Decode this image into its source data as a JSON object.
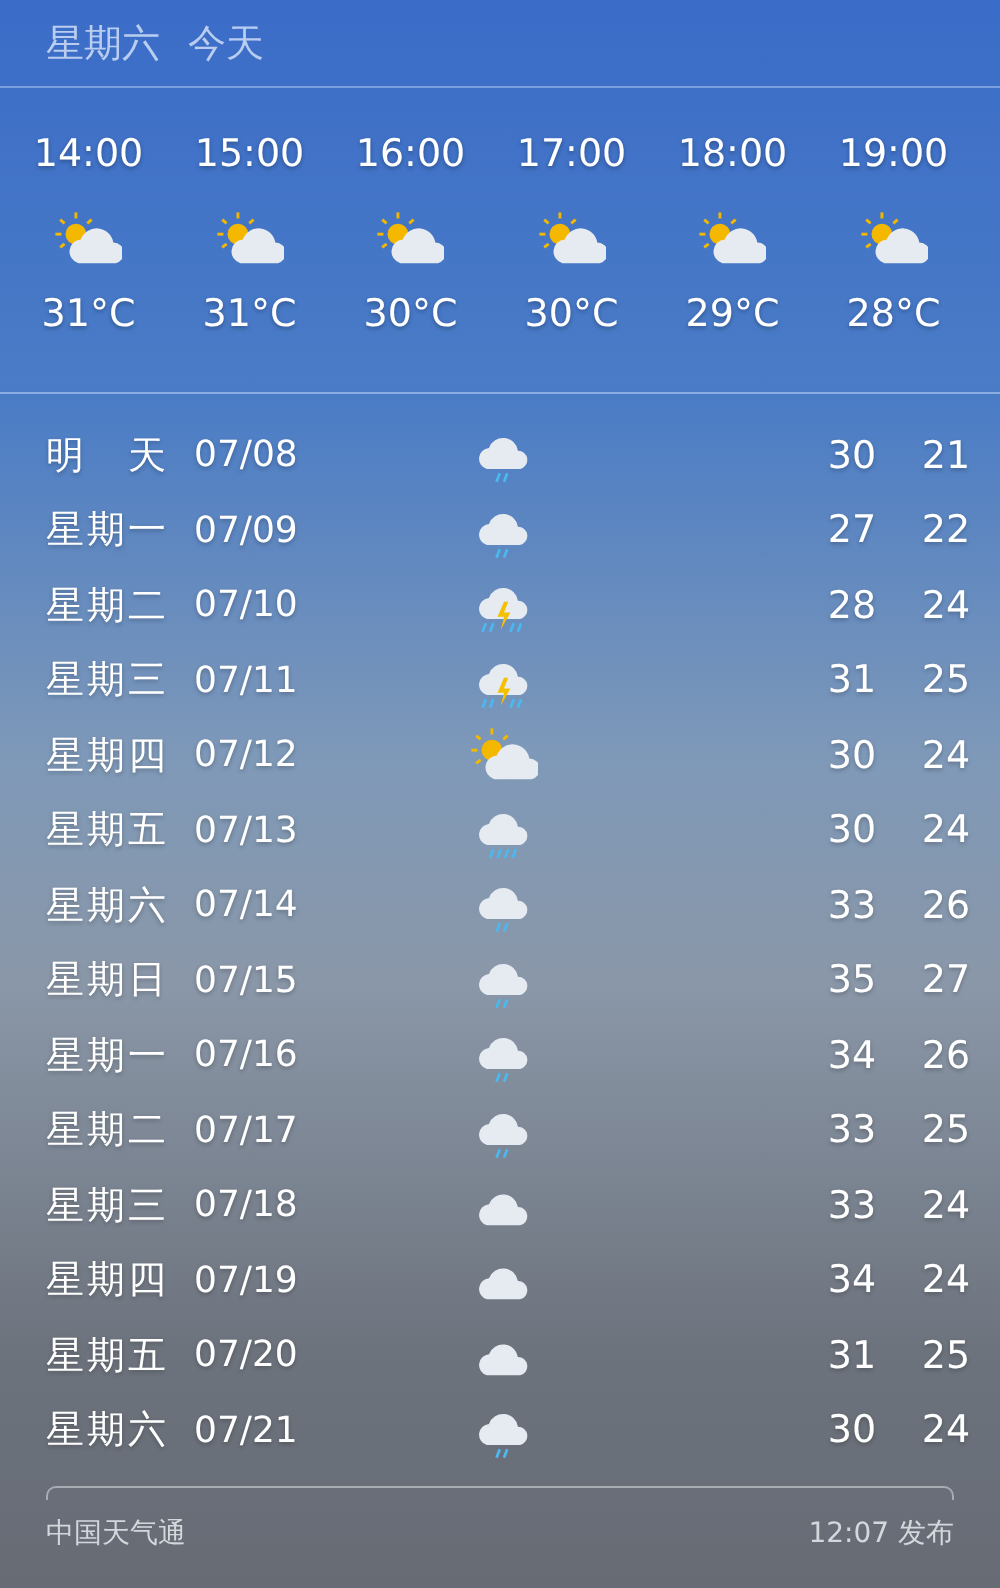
{
  "header": {
    "day": "星期六",
    "label": "今天"
  },
  "hourly": [
    {
      "time": "14:00",
      "kind": "partly-cloudy",
      "temp": "31°C"
    },
    {
      "time": "15:00",
      "kind": "partly-cloudy",
      "temp": "31°C"
    },
    {
      "time": "16:00",
      "kind": "partly-cloudy",
      "temp": "30°C"
    },
    {
      "time": "17:00",
      "kind": "partly-cloudy",
      "temp": "30°C"
    },
    {
      "time": "18:00",
      "kind": "partly-cloudy",
      "temp": "29°C"
    },
    {
      "time": "19:00",
      "kind": "partly-cloudy",
      "temp": "28°C"
    }
  ],
  "daily": [
    {
      "day": "明天",
      "date": "07/08",
      "kind": "light-rain",
      "high": "30",
      "low": "21"
    },
    {
      "day": "星期一",
      "date": "07/09",
      "kind": "light-rain",
      "high": "27",
      "low": "22"
    },
    {
      "day": "星期二",
      "date": "07/10",
      "kind": "thunderstorm",
      "high": "28",
      "low": "24"
    },
    {
      "day": "星期三",
      "date": "07/11",
      "kind": "thunderstorm",
      "high": "31",
      "low": "25"
    },
    {
      "day": "星期四",
      "date": "07/12",
      "kind": "partly-cloudy",
      "high": "30",
      "low": "24"
    },
    {
      "day": "星期五",
      "date": "07/13",
      "kind": "moderate-rain",
      "high": "30",
      "low": "24"
    },
    {
      "day": "星期六",
      "date": "07/14",
      "kind": "light-rain",
      "high": "33",
      "low": "26"
    },
    {
      "day": "星期日",
      "date": "07/15",
      "kind": "light-rain",
      "high": "35",
      "low": "27"
    },
    {
      "day": "星期一",
      "date": "07/16",
      "kind": "light-rain",
      "high": "34",
      "low": "26"
    },
    {
      "day": "星期二",
      "date": "07/17",
      "kind": "light-rain",
      "high": "33",
      "low": "25"
    },
    {
      "day": "星期三",
      "date": "07/18",
      "kind": "cloudy",
      "high": "33",
      "low": "24"
    },
    {
      "day": "星期四",
      "date": "07/19",
      "kind": "cloudy",
      "high": "34",
      "low": "24"
    },
    {
      "day": "星期五",
      "date": "07/20",
      "kind": "cloudy",
      "high": "31",
      "low": "25"
    },
    {
      "day": "星期六",
      "date": "07/21",
      "kind": "light-rain",
      "high": "30",
      "low": "24"
    }
  ],
  "footer": {
    "source": "中国天气通",
    "published": "12:07 发布"
  }
}
